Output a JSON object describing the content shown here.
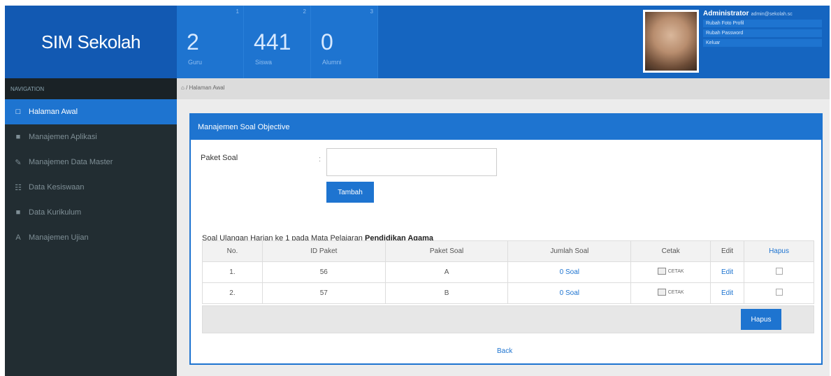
{
  "brand": {
    "title": "SIM Sekolah"
  },
  "stats": [
    {
      "mini": "1",
      "value": "2",
      "label": "Guru"
    },
    {
      "mini": "2",
      "value": "441",
      "label": "Siswa"
    },
    {
      "mini": "3",
      "value": "0",
      "label": "Alumni"
    }
  ],
  "user": {
    "name": "Administrator",
    "email": "admin@sekolah.sc",
    "links": [
      "Rubah Foto Profil",
      "Rubah Password",
      "Keluar"
    ]
  },
  "sidebar": {
    "heading": "NAVIGATION",
    "items": [
      {
        "icon": "□",
        "label": "Halaman Awal",
        "active": true
      },
      {
        "icon": "■",
        "label": "Manajemen Aplikasi"
      },
      {
        "icon": "✎",
        "label": "Manajemen Data Master"
      },
      {
        "icon": "☷",
        "label": "Data Kesiswaan"
      },
      {
        "icon": "■",
        "label": "Data Kurikulum"
      },
      {
        "icon": "A",
        "label": "Manajemen Ujian"
      }
    ]
  },
  "breadcrumb": {
    "home_icon": "⌂",
    "text": "/ Halaman Awal"
  },
  "panel": {
    "title": "Manajemen Soal Objective",
    "field_label": "Paket Soal",
    "colon": ":",
    "input_value": "",
    "add_button": "Tambah",
    "caption_prefix": "Soal Ulangan Harian ke 1 pada Mata Pelajaran",
    "caption_subject": "Pendidikan Agama",
    "delete_button": "Hapus",
    "back_link": "Back"
  },
  "table": {
    "headers": [
      "No.",
      "ID Paket",
      "Paket Soal",
      "Jumlah Soal",
      "Cetak",
      "Edit",
      "Hapus"
    ],
    "rows": [
      {
        "no": "1.",
        "id": "56",
        "paket": "A",
        "jumlah": "0 Soal",
        "cetak": "CETAK",
        "edit": "Edit"
      },
      {
        "no": "2.",
        "id": "57",
        "paket": "B",
        "jumlah": "0 Soal",
        "cetak": "CETAK",
        "edit": "Edit"
      }
    ]
  },
  "colors": {
    "primary": "#1e74d0",
    "header": "#1565c0",
    "sidebar": "#222d32"
  }
}
